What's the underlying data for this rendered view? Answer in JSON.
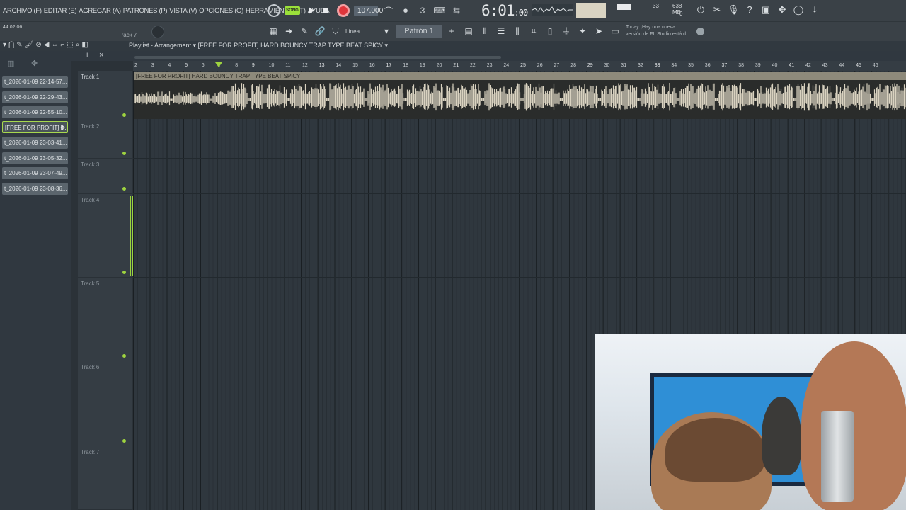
{
  "menu": {
    "items": [
      "ARCHIVO (F)",
      "EDITAR (E)",
      "AGREGAR (A)",
      "PATRONES (P)",
      "VISTA (V)",
      "OPCIONES (O)",
      "HERRAMIENTAS (T)",
      "AYUDA"
    ]
  },
  "transport": {
    "song_label": "SONG",
    "tempo": "107.000",
    "time": "6:01",
    "time_small": ":00",
    "cpu_value": "33",
    "memory": "638 MB",
    "memory_sub": "0"
  },
  "toolbar2": {
    "elapsed": "44:02:06",
    "current_track": "Track 7",
    "snap": "Línea",
    "pattern": "Patrón 1",
    "news_line1": "Today  ¡Hay una nueva",
    "news_line2": "versión de FL Studio está d..."
  },
  "playlist": {
    "breadcrumb": "Playlist - Arrangement",
    "clip_name": "[FREE FOR PROFIT] HARD BOUNCY TRAP TYPE BEAT SPICY",
    "audio_clip_title": "[FREE FOR PROFIT] HARD BOUNCY TRAP TYPE BEAT SPICY"
  },
  "clips": [
    "t_2026-01-09 22-14-57...",
    "t_2026-01-09 22-29-43...",
    "t_2026-01-09 22-55-10...",
    "[FREE FOR PROFIT] H...",
    "t_2026-01-09 23-03-41...",
    "t_2026-01-09 23-05-32...",
    "t_2026-01-09 23-07-49...",
    "t_2026-01-09 23-08-36..."
  ],
  "tracks": [
    "Track 1",
    "Track 2",
    "Track 3",
    "Track 4",
    "Track 5",
    "Track 6",
    "Track 7"
  ],
  "ruler": [
    "2",
    "3",
    "4",
    "5",
    "6",
    "7",
    "8",
    "9",
    "10",
    "11",
    "12",
    "13",
    "14",
    "15",
    "16",
    "17",
    "18",
    "19",
    "20",
    "21",
    "22",
    "23",
    "24",
    "25",
    "26",
    "27",
    "28",
    "29",
    "30",
    "31",
    "32",
    "33",
    "34",
    "35",
    "36",
    "37",
    "38",
    "39",
    "40",
    "41",
    "42",
    "43",
    "44",
    "45",
    "46"
  ]
}
